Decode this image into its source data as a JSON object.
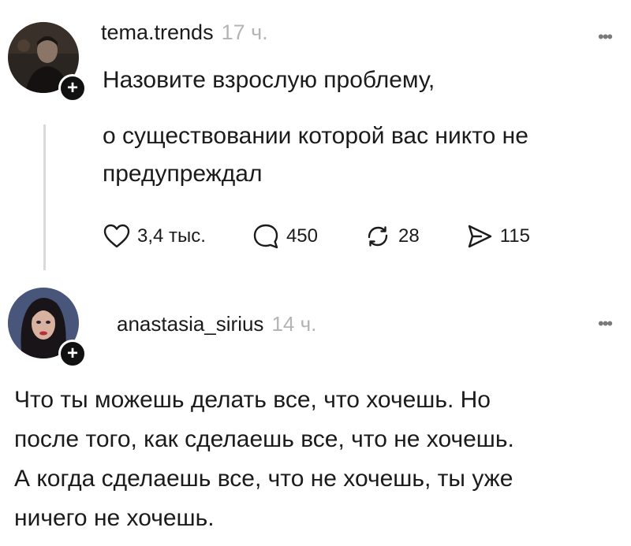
{
  "post1": {
    "username": "tema.trends",
    "time": "17 ч.",
    "text_lines": [
      "Назовите взрослую проблему,",
      "о существовании которой вас никто не",
      "предупреждал"
    ],
    "actions": {
      "likes": "3,4 тыс.",
      "comments": "450",
      "reposts": "28",
      "shares": "115"
    }
  },
  "post2": {
    "username": "anastasia_sirius",
    "time": "14 ч.",
    "text_lines": [
      "Что ты можешь делать все, что хочешь. Но",
      "после того, как сделаешь все, что не хочешь.",
      "А когда сделаешь все, что не хочешь, ты уже",
      "ничего не хочешь."
    ]
  },
  "ui": {
    "more_label": "•••",
    "plus_label": "+"
  },
  "icons": {
    "like": "heart-icon",
    "comment": "comment-bubble-icon",
    "repost": "repost-icon",
    "share": "send-icon",
    "more": "more-dots-icon"
  }
}
